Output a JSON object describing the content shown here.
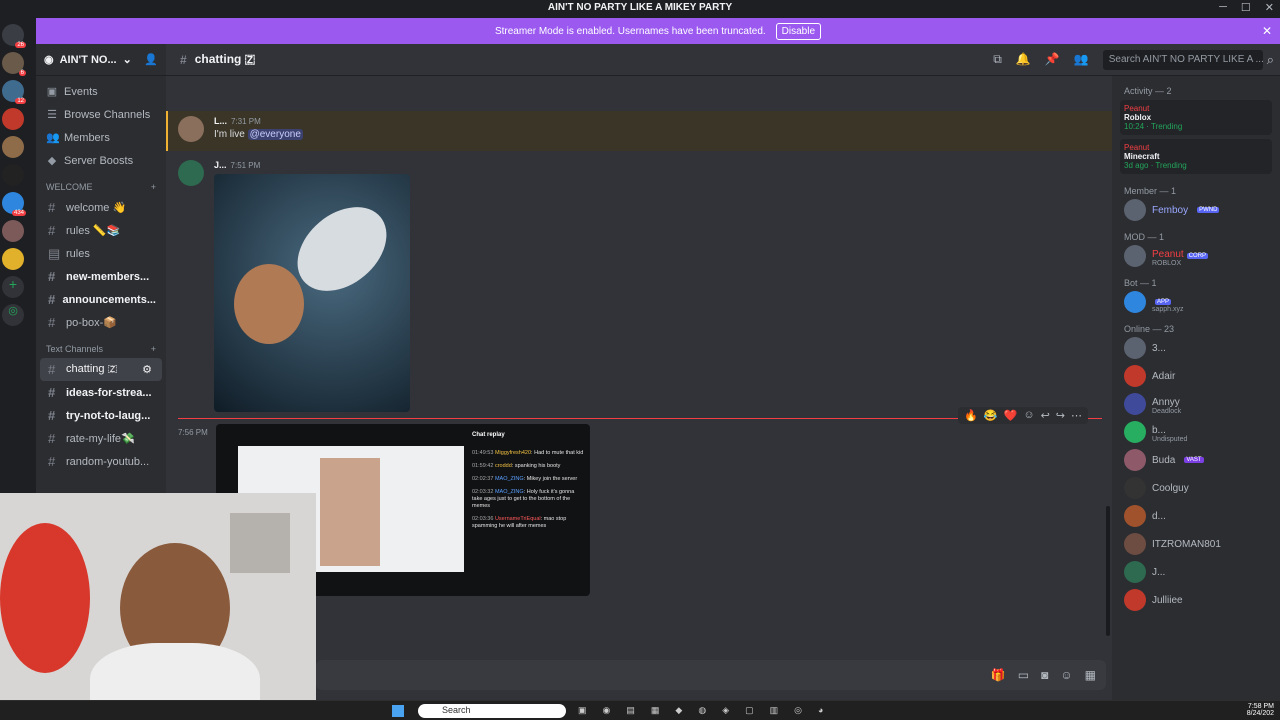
{
  "window": {
    "title": "AIN'T NO PARTY LIKE A MIKEY PARTY",
    "controls": [
      "minimize",
      "maximize",
      "close"
    ]
  },
  "banner": {
    "text": "Streamer Mode is enabled. Usernames have been truncated.",
    "button": "Disable"
  },
  "guild_badges": [
    "26",
    "6",
    "12",
    "434"
  ],
  "server": {
    "name": "AIN'T NO...",
    "nav": [
      "Events",
      "Browse Channels",
      "Members",
      "Server Boosts"
    ],
    "welcome_category": "WELCOME",
    "welcome_channels": [
      {
        "label": "welcome 👋",
        "bold": false
      },
      {
        "label": "rules 📏📚",
        "bold": false
      },
      {
        "label": "rules",
        "bold": false
      },
      {
        "label": "new-members...",
        "bold": true
      },
      {
        "label": "announcements...",
        "bold": true
      },
      {
        "label": "po-box-📦",
        "bold": false
      }
    ],
    "text_category": "Text Channels",
    "text_channels": [
      {
        "label": "chatting 🇿",
        "active": true
      },
      {
        "label": "ideas-for-strea...",
        "bold": true
      },
      {
        "label": "try-not-to-laug...",
        "bold": true
      },
      {
        "label": "rate-my-life💸",
        "bold": false
      },
      {
        "label": "random-youtub...",
        "bold": false
      }
    ]
  },
  "header": {
    "channel": "chatting 🇿",
    "search_placeholder": "Search AIN'T NO PARTY LIKE A ..."
  },
  "messages": [
    {
      "author": "L...",
      "time": "7:31 PM",
      "text_prefix": "I'm live ",
      "mention": "@everyone"
    },
    {
      "author": "J...",
      "time": "7:51 PM",
      "text_prefix": "",
      "mention": ""
    },
    {
      "author": "",
      "time": "7:56 PM",
      "text_prefix": "",
      "mention": ""
    }
  ],
  "embed": {
    "title": "Chat replay",
    "lines": [
      {
        "ts": "01:49:53",
        "user": "Miggyfresh420",
        "msg": "Had to mute that kid"
      },
      {
        "ts": "01:59:42",
        "user": "croddd",
        "msg": "spanking his booty"
      },
      {
        "ts": "02:02:37",
        "user": "MAO_ZING",
        "msg": "Mikey join the server"
      },
      {
        "ts": "02:03:32",
        "user": "MAO_ZING",
        "msg": "Holy fuck it's gonna take ages just to get to the bottom of the memes"
      },
      {
        "ts": "02:03:36",
        "user": "UsernameTriEqual",
        "msg": "mao stop spamming he will after memes"
      }
    ]
  },
  "reactions": [
    "🔥",
    "😂",
    "❤️"
  ],
  "members": {
    "activity_title": "Activity — 2",
    "activities": [
      {
        "user": "Peanut",
        "game": "Roblox",
        "meta": "10:24 · Trending"
      },
      {
        "user": "Peanut",
        "game": "Minecraft",
        "meta": "3d ago · Trending"
      }
    ],
    "groups": [
      {
        "title": "Member — 1",
        "rows": [
          {
            "name": "Femboy",
            "tag": "PWND",
            "sub": ""
          }
        ]
      },
      {
        "title": "MOD — 1",
        "rows": [
          {
            "name": "Peanut",
            "tag": "CORP",
            "sub": "ROBLOX"
          }
        ]
      },
      {
        "title": "Bot — 1",
        "rows": [
          {
            "name": "",
            "tag": "APP",
            "sub": "sapph.xyz"
          }
        ]
      },
      {
        "title": "Online — 23",
        "rows": [
          {
            "name": "3...",
            "tag": "",
            "sub": ""
          },
          {
            "name": "Adair",
            "tag": "",
            "sub": ""
          },
          {
            "name": "Annyy",
            "tag": "",
            "sub": "Deadlock"
          },
          {
            "name": "b...",
            "tag": "",
            "sub": "Undisputed"
          },
          {
            "name": "Buda",
            "tag": "VAST",
            "sub": ""
          },
          {
            "name": "Coolguy",
            "tag": "",
            "sub": ""
          },
          {
            "name": "d...",
            "tag": "",
            "sub": ""
          },
          {
            "name": "ITZROMAN801",
            "tag": "",
            "sub": ""
          },
          {
            "name": "J...",
            "tag": "",
            "sub": ""
          },
          {
            "name": "Julliiee",
            "tag": "",
            "sub": ""
          }
        ]
      }
    ]
  },
  "taskbar": {
    "search_placeholder": "Search",
    "time": "7:58 PM",
    "date": "8/24/202"
  }
}
